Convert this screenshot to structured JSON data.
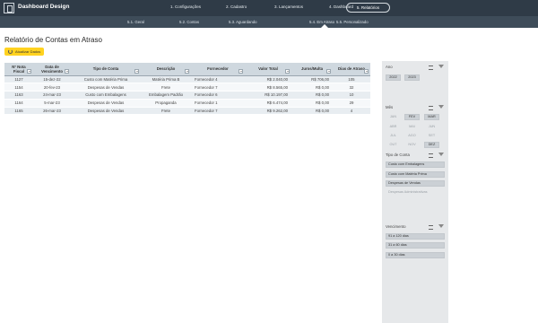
{
  "app": {
    "title": "Dashboard Design"
  },
  "nav": {
    "items": [
      {
        "label": "1. Configurações"
      },
      {
        "label": "2. Cadastro"
      },
      {
        "label": "3. Lançamentos"
      },
      {
        "label": "4. Dashboard"
      },
      {
        "label": "5. Relatórios",
        "active": true
      }
    ]
  },
  "subnav": {
    "items": [
      {
        "label": "5.1. Geral"
      },
      {
        "label": "5.2. Contas"
      },
      {
        "label": "5.3. Aguardando"
      },
      {
        "label": "5.4. Em Atraso",
        "active": true
      },
      {
        "label": "5.5. Personalizado"
      }
    ]
  },
  "page": {
    "title": "Relatório de Contas em Atraso",
    "update_button": "Atualizar Dados"
  },
  "table": {
    "headers": [
      "Nº Nota Fiscal",
      "Data de Vencimento",
      "Tipo de Conta",
      "Descrição",
      "Fornecedor",
      "Valor Total",
      "Juros/Multa",
      "Dias de Atraso"
    ],
    "rows": [
      [
        "1127",
        "15-dez-22",
        "Custo com Matéria Prima",
        "Matéria Prima B",
        "Fornecedor 4",
        "R$ 2.040,00",
        "R$ 706,00",
        "105"
      ],
      [
        "1154",
        "20-fev-23",
        "Despesas de Vendas",
        "Frete",
        "Fornecedor 7",
        "R$ 8.565,00",
        "R$ 0,00",
        "32"
      ],
      [
        "1163",
        "24-mar-23",
        "Custo com Embalagens",
        "Embalagem Padrão",
        "Fornecedor 6",
        "R$ 10.197,00",
        "R$ 0,00",
        "10"
      ],
      [
        "1164",
        "5-mar-23",
        "Despesas de Vendas",
        "Propaganda",
        "Fornecedor 1",
        "R$ 6.474,00",
        "R$ 0,00",
        "29"
      ],
      [
        "1165",
        "26-mar-23",
        "Despesas de Vendas",
        "Frete",
        "Fornecedor 7",
        "R$ 9.262,00",
        "R$ 0,00",
        "4"
      ]
    ]
  },
  "slicers": {
    "ano": {
      "title": "Ano",
      "items": [
        "2022",
        "2023"
      ]
    },
    "mes": {
      "title": "Mês",
      "items": [
        "JAN",
        "FEV",
        "MAR",
        "ABR",
        "MAI",
        "JUN",
        "JUL",
        "AGO",
        "SET",
        "OUT",
        "NOV",
        "DEZ"
      ]
    },
    "tipo": {
      "title": "Tipo de Conta",
      "items": [
        "Custo com Embalagens",
        "Custo com Matéria Prima",
        "Despesas de Vendas",
        "Despesas Administrativas"
      ]
    },
    "vencimento": {
      "title": "Vencimento",
      "items": [
        "91 a 120 dias",
        "31 a 60 dias",
        "0 a 30 dias"
      ]
    }
  },
  "icons": {
    "logo": "dashboard-logo-icon",
    "refresh": "refresh-icon",
    "multiselect": "multi-select-icon",
    "clear_filter": "clear-filter-icon",
    "dropdown": "dropdown-arrow-icon"
  },
  "colors": {
    "topbar": "#2f3b47",
    "subbar": "#3e4c59",
    "accent": "#ffd21f",
    "header": "#cfd8df",
    "panel": "#e6e8ea"
  }
}
